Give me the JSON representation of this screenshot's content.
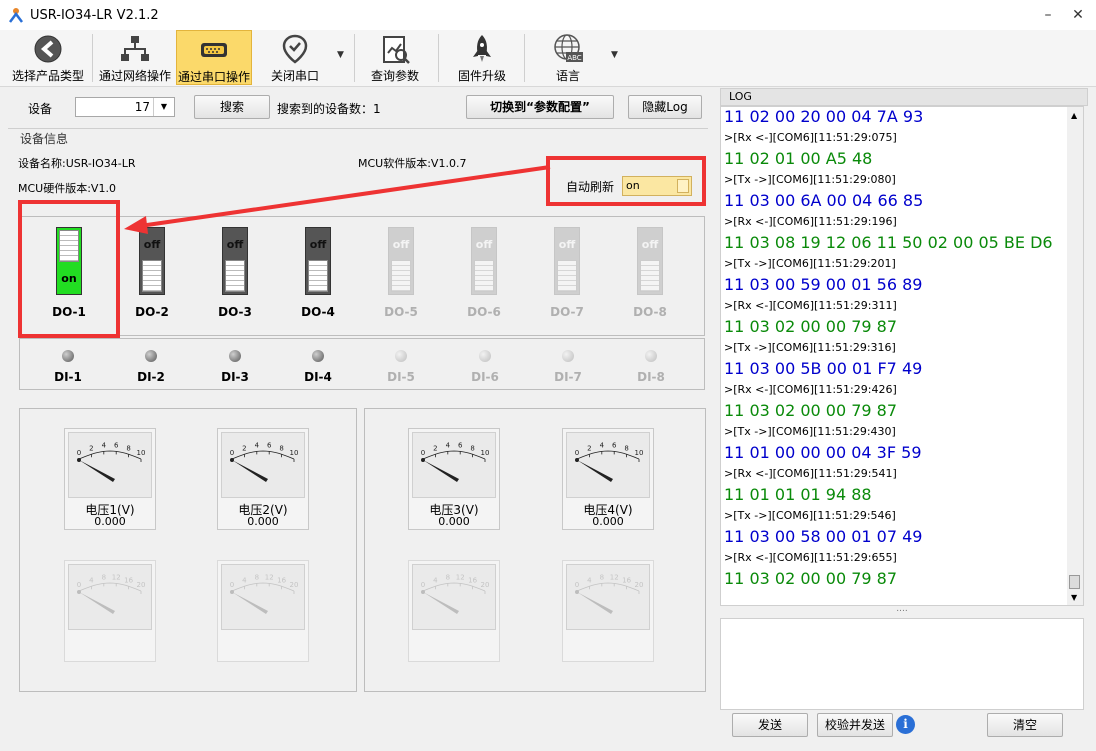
{
  "window": {
    "title": "USR-IO34-LR V2.1.2"
  },
  "toolbar": {
    "items": [
      {
        "label": "选择产品类型",
        "icon": "back-arrow-icon"
      },
      {
        "label": "通过网络操作",
        "icon": "network-icon"
      },
      {
        "label": "通过串口操作",
        "icon": "serial-port-icon"
      },
      {
        "label": "关闭串口",
        "icon": "location-check-icon"
      },
      {
        "label": "查询参数",
        "icon": "document-chart-icon"
      },
      {
        "label": "固件升级",
        "icon": "rocket-icon"
      },
      {
        "label": "语言",
        "icon": "globe-abc-icon"
      }
    ]
  },
  "device_bar": {
    "device_label": "设备",
    "device_value": "17",
    "search_label": "搜索",
    "found_label": "搜索到的设备数：1",
    "switch_label": "切换到“参数配置”",
    "hide_log_label": "隐藏Log"
  },
  "device_info": {
    "group_title": "设备信息",
    "name": "设备名称:USR-IO34-LR",
    "mcu_sw": "MCU软件版本:V1.0.7",
    "mcu_hw": "MCU硬件版本:V1.0",
    "auto_refresh_label": "自动刷新",
    "auto_refresh_value": "on"
  },
  "outputs": [
    {
      "label": "DO-1",
      "state": "on"
    },
    {
      "label": "DO-2",
      "state": "off"
    },
    {
      "label": "DO-3",
      "state": "off"
    },
    {
      "label": "DO-4",
      "state": "off"
    },
    {
      "label": "DO-5",
      "state": "off"
    },
    {
      "label": "DO-6",
      "state": "off"
    },
    {
      "label": "DO-7",
      "state": "off"
    },
    {
      "label": "DO-8",
      "state": "off"
    }
  ],
  "inputs": [
    {
      "label": "DI-1"
    },
    {
      "label": "DI-2"
    },
    {
      "label": "DI-3"
    },
    {
      "label": "DI-4"
    },
    {
      "label": "DI-5"
    },
    {
      "label": "DI-6"
    },
    {
      "label": "DI-7"
    },
    {
      "label": "DI-8"
    }
  ],
  "gauges": [
    {
      "name": "电压1(V)",
      "value": "0.000",
      "ticks": [
        "0",
        "2",
        "4",
        "6",
        "8",
        "10"
      ]
    },
    {
      "name": "电压2(V)",
      "value": "0.000",
      "ticks": [
        "0",
        "2",
        "4",
        "6",
        "8",
        "10"
      ]
    },
    {
      "name": "电压3(V)",
      "value": "0.000",
      "ticks": [
        "0",
        "2",
        "4",
        "6",
        "8",
        "10"
      ]
    },
    {
      "name": "电压4(V)",
      "value": "0.000",
      "ticks": [
        "0",
        "2",
        "4",
        "6",
        "8",
        "10"
      ]
    }
  ],
  "gauges_dim_ticks": [
    "0",
    "4",
    "8",
    "12",
    "16",
    "20"
  ],
  "log": {
    "title": "LOG",
    "lines": [
      {
        "kind": "rx",
        "text": "11 02 00 20 00 04 7A 93"
      },
      {
        "kind": "meta",
        "text": ">[Rx <-][COM6][11:51:29:075]"
      },
      {
        "kind": "tx",
        "text": "11 02 01 00 A5 48"
      },
      {
        "kind": "meta",
        "text": ">[Tx ->][COM6][11:51:29:080]"
      },
      {
        "kind": "rx",
        "text": "11 03 00 6A 00 04 66 85"
      },
      {
        "kind": "meta",
        "text": ">[Rx <-][COM6][11:51:29:196]"
      },
      {
        "kind": "tx",
        "text": "11 03 08 19 12 06 11 50 02 00 05 BE D6"
      },
      {
        "kind": "meta",
        "text": ">[Tx ->][COM6][11:51:29:201]"
      },
      {
        "kind": "rx",
        "text": "11 03 00 59 00 01 56 89"
      },
      {
        "kind": "meta",
        "text": ">[Rx <-][COM6][11:51:29:311]"
      },
      {
        "kind": "tx",
        "text": "11 03 02 00 00 79 87"
      },
      {
        "kind": "meta",
        "text": ">[Tx ->][COM6][11:51:29:316]"
      },
      {
        "kind": "rx",
        "text": "11 03 00 5B 00 01 F7 49"
      },
      {
        "kind": "meta",
        "text": ">[Rx <-][COM6][11:51:29:426]"
      },
      {
        "kind": "tx",
        "text": "11 03 02 00 00 79 87"
      },
      {
        "kind": "meta",
        "text": ">[Tx ->][COM6][11:51:29:430]"
      },
      {
        "kind": "rx",
        "text": "11 01 00 00 00 04 3F 59"
      },
      {
        "kind": "meta",
        "text": ">[Rx <-][COM6][11:51:29:541]"
      },
      {
        "kind": "tx",
        "text": "11 01 01 01 94 88"
      },
      {
        "kind": "meta",
        "text": ">[Tx ->][COM6][11:51:29:546]"
      },
      {
        "kind": "rx",
        "text": "11 03 00 58 00 01 07 49"
      },
      {
        "kind": "meta",
        "text": ">[Rx <-][COM6][11:51:29:655]"
      },
      {
        "kind": "tx",
        "text": "11 03 02 00 00 79 87"
      }
    ],
    "splitter": "....",
    "send_label": "发送",
    "verify_send_label": "校验并发送",
    "info_label": "i",
    "clear_label": "清空"
  },
  "colors": {
    "rx": "#0000cc",
    "tx": "#0a8a0a",
    "highlight": "#ee3333",
    "on_green": "#22dd22"
  }
}
